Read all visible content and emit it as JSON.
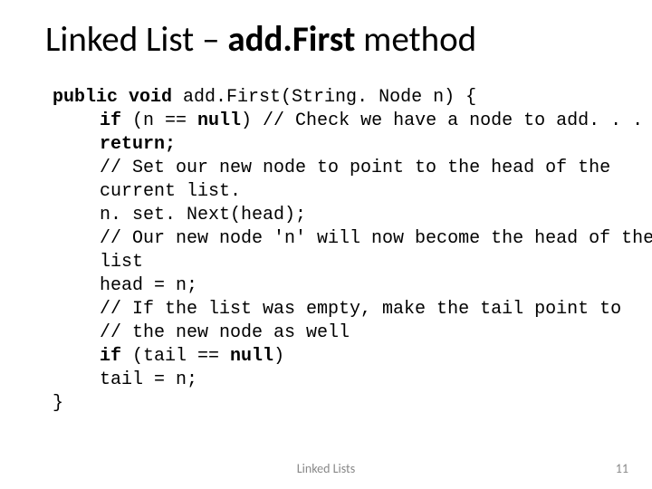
{
  "title": {
    "prefix": "Linked List – ",
    "accent": "add.First",
    "suffix": " method"
  },
  "code": {
    "l1_a": "public void ",
    "l1_b": "add.First(String. Node n) {",
    "l2_a": "if ",
    "l2_b": "(n == ",
    "l2_c": "null",
    "l2_d": ") // Check we have a node to add. . .",
    "l3": "return;",
    "l4": "// Set our new node to point to the head of the",
    "l5": "current list.",
    "l6": "n. set. Next(head);",
    "l7": "// Our new node 'n' will now become the head of the",
    "l8": "list",
    "l9": "head = n;",
    "l10": "// If the list was empty, make the tail point to",
    "l11": "// the new node as well",
    "l12_a": "if ",
    "l12_b": "(tail == ",
    "l12_c": "null",
    "l12_d": ")",
    "l13": "tail = n;",
    "l14": "}"
  },
  "footer": {
    "center": "Linked Lists",
    "page": "11"
  }
}
